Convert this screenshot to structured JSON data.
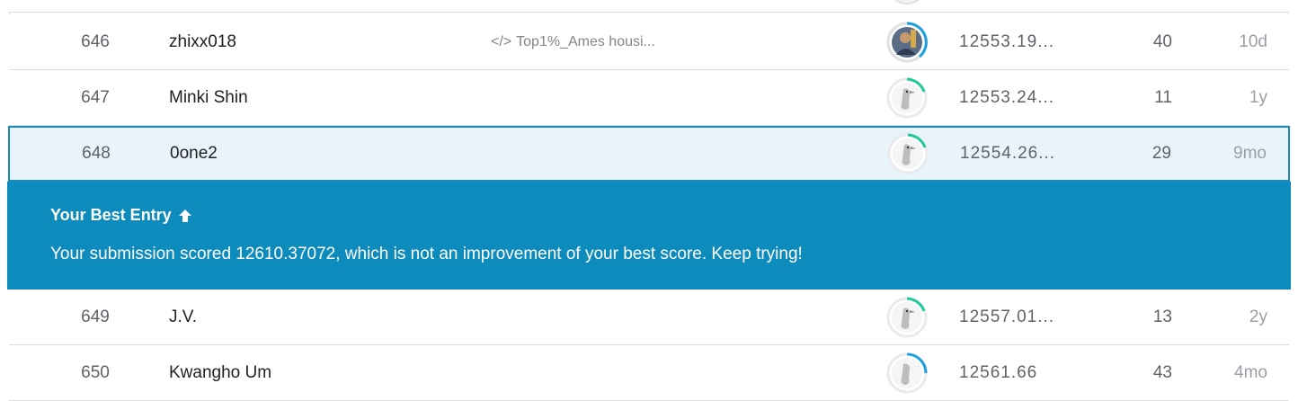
{
  "rows": [
    {
      "rank": "646",
      "team": "zhixx018",
      "notebook": "Top1%_Ames housi...",
      "score": "12553.19...",
      "entries": "40",
      "last": "10d",
      "avatar": "photo",
      "ring": "#1ba1e2"
    },
    {
      "rank": "647",
      "team": "Minki Shin",
      "notebook": "",
      "score": "12553.24...",
      "entries": "11",
      "last": "1y",
      "avatar": "goose",
      "ring": "#20beff"
    },
    {
      "rank": "648",
      "team": "0one2",
      "notebook": "",
      "score": "12554.26...",
      "entries": "29",
      "last": "9mo",
      "avatar": "goose",
      "ring": "#20c997"
    },
    {
      "rank": "649",
      "team": "J.V.",
      "notebook": "",
      "score": "12557.01...",
      "entries": "13",
      "last": "2y",
      "avatar": "goose",
      "ring": "#20c997"
    },
    {
      "rank": "650",
      "team": "Kwangho Um",
      "notebook": "",
      "score": "12561.66",
      "entries": "43",
      "last": "4mo",
      "avatar": "goose",
      "ring": "#1ba1e2"
    }
  ],
  "banner": {
    "title": "Your Best Entry",
    "message": "Your submission scored 12610.37072, which is not an improvement of your best score. Keep trying!"
  },
  "colors": {
    "accent": "#0d8bbd",
    "highlight_bg": "#e8f4fa",
    "border": "#dadce0"
  }
}
